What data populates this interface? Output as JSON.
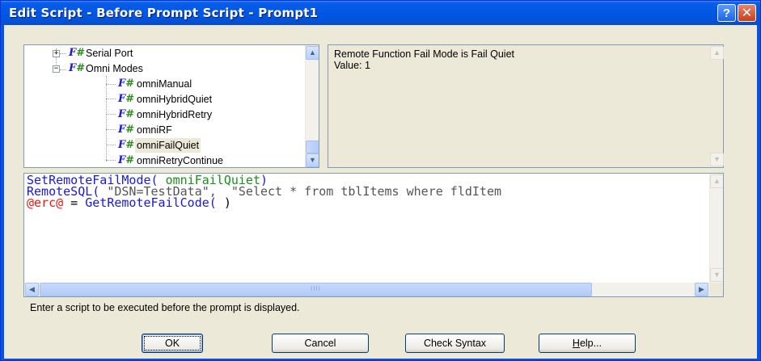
{
  "window": {
    "title": "Edit Script - Before Prompt Script - Prompt1",
    "help_glyph": "?",
    "close_glyph": "✕"
  },
  "tree": {
    "icon_f": "F",
    "icon_hash": "#",
    "items": [
      {
        "label": "Serial Port",
        "expander": "+"
      },
      {
        "label": "Omni Modes",
        "expander": "−"
      },
      {
        "label": "omniManual"
      },
      {
        "label": "omniHybridQuiet"
      },
      {
        "label": "omniHybridRetry"
      },
      {
        "label": "omniRF"
      },
      {
        "label": "omniFailQuiet",
        "selected": true
      },
      {
        "label": "omniRetryContinue"
      }
    ]
  },
  "description": {
    "line1": "Remote Function Fail Mode is Fail Quiet",
    "line2": "Value: 1"
  },
  "editor": {
    "line1_fn": "SetRemoteFailMode(",
    "line1_arg": " omniFailQuiet",
    "line1_close": ")",
    "line2_fn": "RemoteSQL(",
    "line2_args": " \"DSN=TestData\",  \"Select * from tblItems where fldItem",
    "line3_var": "@erc@",
    "line3_eq": " = ",
    "line3_fn": "GetRemoteFailCode(",
    "line3_close": " )"
  },
  "scroll": {
    "up": "▲",
    "down": "▼",
    "left": "◀",
    "right": "▶",
    "grip": "IIII"
  },
  "instructions": "Enter a script to be executed before the prompt is displayed.",
  "buttons": {
    "ok": "OK",
    "cancel": "Cancel",
    "check_syntax": "Check Syntax",
    "help_first": "H",
    "help_rest": "elp..."
  }
}
